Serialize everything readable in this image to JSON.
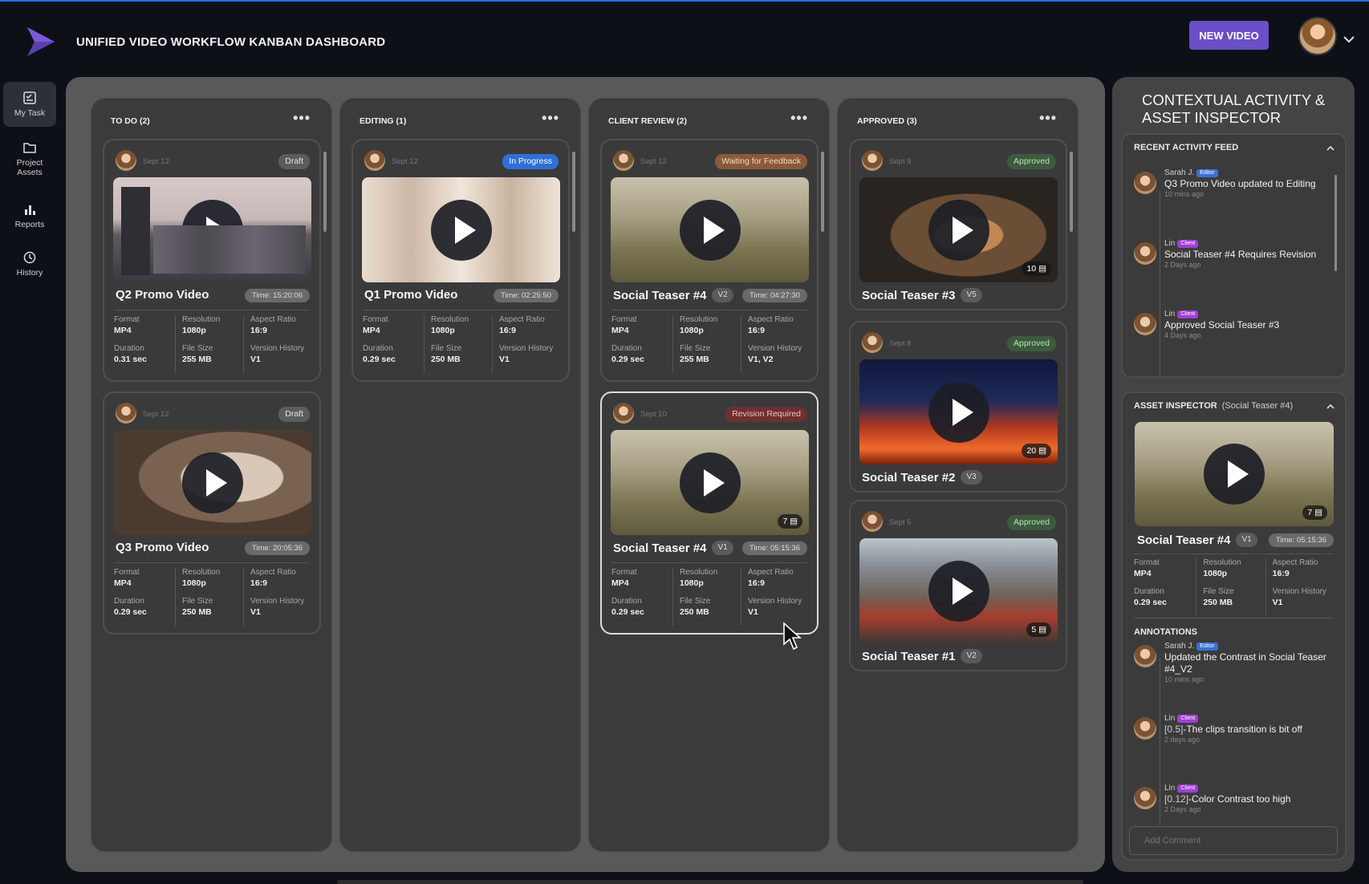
{
  "app": {
    "title": "UNIFIED VIDEO WORKFLOW KANBAN DASHBOARD",
    "new_video_label": "NEW VIDEO",
    "logo_icon": "play-triangle-logo",
    "accent": "#6b4fc6"
  },
  "nav": [
    {
      "label": "My Task",
      "icon": "checklist-icon",
      "active": true
    },
    {
      "label": "Project Assets",
      "icon": "folder-icon",
      "active": false
    },
    {
      "label": "Reports",
      "icon": "bar-chart-icon",
      "active": false
    },
    {
      "label": "History",
      "icon": "history-icon",
      "active": false
    }
  ],
  "meta_labels": {
    "format": "Format",
    "resolution": "Resolution",
    "aspect": "Aspect Ratio",
    "duration": "Duration",
    "size": "File Size",
    "history": "Version History"
  },
  "columns": [
    {
      "title": "TO DO (2)",
      "menu": "•••",
      "cards": [
        {
          "date": "Sept 12",
          "status": "Draft",
          "title": "Q2 Promo Video",
          "version": "",
          "time": "Time: 15:20:06",
          "comments": "",
          "format": "MP4",
          "resolution": "1080p",
          "aspect": "16:9",
          "duration": "0.31 sec",
          "size": "255 MB",
          "history": "V1"
        },
        {
          "date": "Sept 12",
          "status": "Draft",
          "title": "Q3 Promo Video",
          "version": "",
          "time": "Time: 20:05:36",
          "comments": "",
          "format": "MP4",
          "resolution": "1080p",
          "aspect": "16:9",
          "duration": "0.29 sec",
          "size": "250 MB",
          "history": "V1"
        }
      ]
    },
    {
      "title": "EDITING (1)",
      "menu": "•••",
      "cards": [
        {
          "date": "Sept 12",
          "status": "In Progress",
          "title": "Q1 Promo Video",
          "version": "",
          "time": "Time: 02:25:50",
          "comments": "",
          "format": "MP4",
          "resolution": "1080p",
          "aspect": "16:9",
          "duration": "0.29 sec",
          "size": "250 MB",
          "history": "V1"
        }
      ]
    },
    {
      "title": "CLIENT REVIEW (2)",
      "menu": "•••",
      "cards": [
        {
          "date": "Sept 12",
          "status": "Waiting for Feedback",
          "title": "Social Teaser #4",
          "version": "V2",
          "time": "Time: 04:27:30",
          "comments": "",
          "format": "MP4",
          "resolution": "1080p",
          "aspect": "16:9",
          "duration": "0.29 sec",
          "size": "255 MB",
          "history": "V1, V2"
        },
        {
          "date": "Sept 10",
          "status": "Revision Required",
          "title": "Social Teaser #4",
          "version": "V1",
          "time": "Time: 05:15:36",
          "comments": "7",
          "format": "MP4",
          "resolution": "1080p",
          "aspect": "16:9",
          "duration": "0.29 sec",
          "size": "250 MB",
          "history": "V1"
        }
      ]
    },
    {
      "title": "APPROVED (3)",
      "menu": "•••",
      "cards": [
        {
          "date": "Sept 9",
          "status": "Approved",
          "title": "Social Teaser #3",
          "version": "V5",
          "comments": "10"
        },
        {
          "date": "Sept 8",
          "status": "Approved",
          "title": "Social Teaser #2",
          "version": "V3",
          "comments": "20"
        },
        {
          "date": "Sept 5",
          "status": "Approved",
          "title": "Social Teaser #1",
          "version": "V2",
          "comments": "5"
        }
      ]
    }
  ],
  "inspector": {
    "title": "CONTEXTUAL ACTIVITY & ASSET INSPECTOR",
    "feed_title": "RECENT ACTIVITY FEED",
    "feed": [
      {
        "name": "Sarah J.",
        "role": "Editor",
        "text": "Q3 Promo Video updated to Editing",
        "time": "10 mins ago"
      },
      {
        "name": "Lin",
        "role": "Client",
        "text": "Social Teaser #4 Requires Revision",
        "time": "2 Days ago"
      },
      {
        "name": "Lin",
        "role": "Client",
        "text": "Approved Social Teaser #3",
        "time": "4 Days ago"
      }
    ],
    "asset_title": "ASSET INSPECTOR",
    "asset_sub": "(Social Teaser #4)",
    "asset": {
      "title": "Social Teaser #4",
      "version": "V1",
      "time": "Time: 05:15:36",
      "comments": "7",
      "format": "MP4",
      "resolution": "1080p",
      "aspect": "16:9",
      "duration": "0.29 sec",
      "size": "250 MB",
      "history": "V1"
    },
    "annotations_title": "ANNOTATIONS",
    "annotations": [
      {
        "name": "Sarah J.",
        "role": "Editor",
        "tag": "",
        "text": "Updated the Contrast in Social Teaser #4_V2",
        "time": "10 mins ago"
      },
      {
        "name": "Lin",
        "role": "Client",
        "tag": "[0.5]",
        "text": "-The clips transition is bit off",
        "time": "2 days ago"
      },
      {
        "name": "Lin",
        "role": "Client",
        "tag": "[0.12]",
        "text": "-Color Contrast too high",
        "time": "2 Days ago"
      }
    ],
    "comment_placeholder": "Add Comment"
  },
  "status_colors": {
    "draft": "#5c5c5c",
    "in_progress": "#2f6fd6",
    "waiting": "#8a5a3a",
    "approved": "#3d5a3f",
    "revision": "#6e2f2f"
  }
}
